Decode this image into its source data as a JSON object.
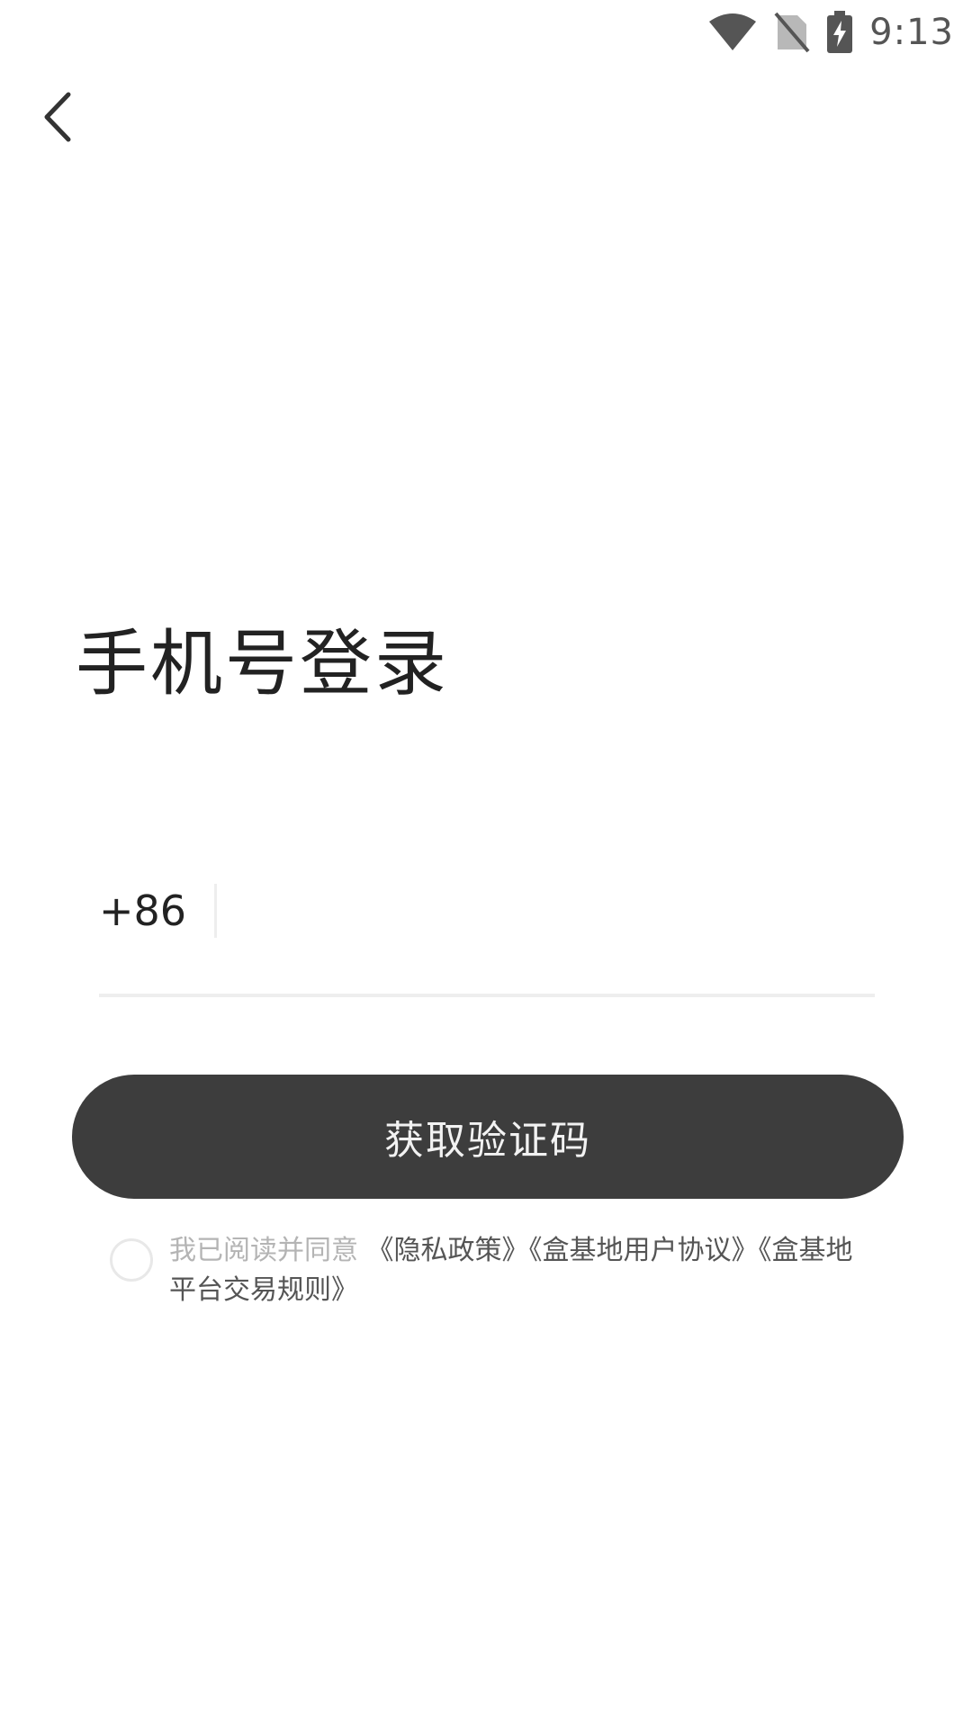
{
  "status_bar": {
    "time": "9:13",
    "icons": [
      "wifi-icon",
      "no-sim-icon",
      "battery-charging-icon"
    ]
  },
  "header": {
    "back_icon": "chevron-left-icon"
  },
  "title": "手机号登录",
  "phone": {
    "country_code": "+86",
    "value": "",
    "placeholder": ""
  },
  "submit": {
    "label": "获取验证码"
  },
  "agreement": {
    "checked": false,
    "prefix": "我已阅读并同意",
    "links": [
      "《隐私政策》",
      "《盒基地用户协议》",
      "《盒基地平台交易规则》"
    ]
  },
  "colors": {
    "background": "#ffffff",
    "button": "#3d3d3d",
    "button_text": "#f2f2f2",
    "muted_text": "#b4b4b4"
  }
}
